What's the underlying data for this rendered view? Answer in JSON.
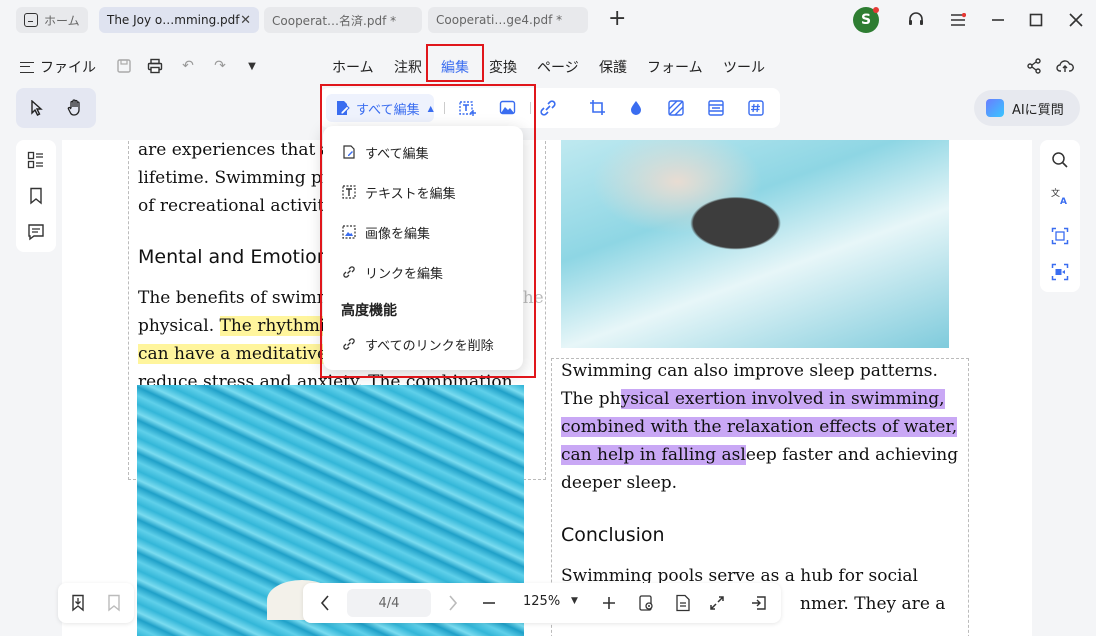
{
  "tabs": {
    "home_label": "ホーム",
    "active_label": "The Joy o…mming.pdf",
    "tab3_label": "Cooperat…名済.pdf *",
    "tab4_label": "Cooperati…ge4.pdf *",
    "close_glyph": "✕"
  },
  "user": {
    "avatar_initial": "S"
  },
  "menubar": {
    "file_label": "ファイル",
    "items": [
      "ホーム",
      "注釈",
      "編集",
      "変換",
      "ページ",
      "保護",
      "フォーム",
      "ツール"
    ],
    "selected": "編集"
  },
  "toolstrip": {
    "edit_all_label": "すべて編集"
  },
  "ai_button": {
    "label": "AIに質問"
  },
  "dropdown": {
    "items": [
      "すべて編集",
      "テキストを編集",
      "画像を編集",
      "リンクを編集"
    ],
    "advanced_header": "高度機能",
    "advanced_items": [
      "すべてのリンクを削除"
    ]
  },
  "document": {
    "left_para1": [
      "are experiences that a",
      "lifetime. Swimming pr",
      "of recreational activiti"
    ],
    "left_heading": "Mental and Emotion",
    "left_para2_line1": "The benefits of swimm",
    "left_para2_line1_tail": "l beyond the",
    "left_para2_line2_plain": "physical. ",
    "left_para2_line2_hl": "The rhythmi",
    "left_para2_line3_hl": "can have a meditative",
    "left_para2_line4": "reduce stress and anxiety. The combination",
    "right_para1": {
      "l1": "Swimming can also improve sleep patterns.",
      "l2_plain": "The ph",
      "l2_hl": "ysical exertion involved in swimming,",
      "l3_hl": "combined with the relaxation effects of water,",
      "l4_hl": "can help in falling asl",
      "l4_plain": "eep faster and achieving",
      "l5": "deeper sleep."
    },
    "right_heading": "Conclusion",
    "right_para2": [
      "Swimming pools serve as a hub for social",
      "nmer. They are a"
    ]
  },
  "bottombar": {
    "page_indicator": "4/4",
    "zoom": "125%"
  },
  "colors": {
    "accent": "#3a6df0",
    "highlight_yellow": "#fff59d",
    "highlight_purple": "#c9a8f5",
    "callout_red": "#e0161b"
  }
}
